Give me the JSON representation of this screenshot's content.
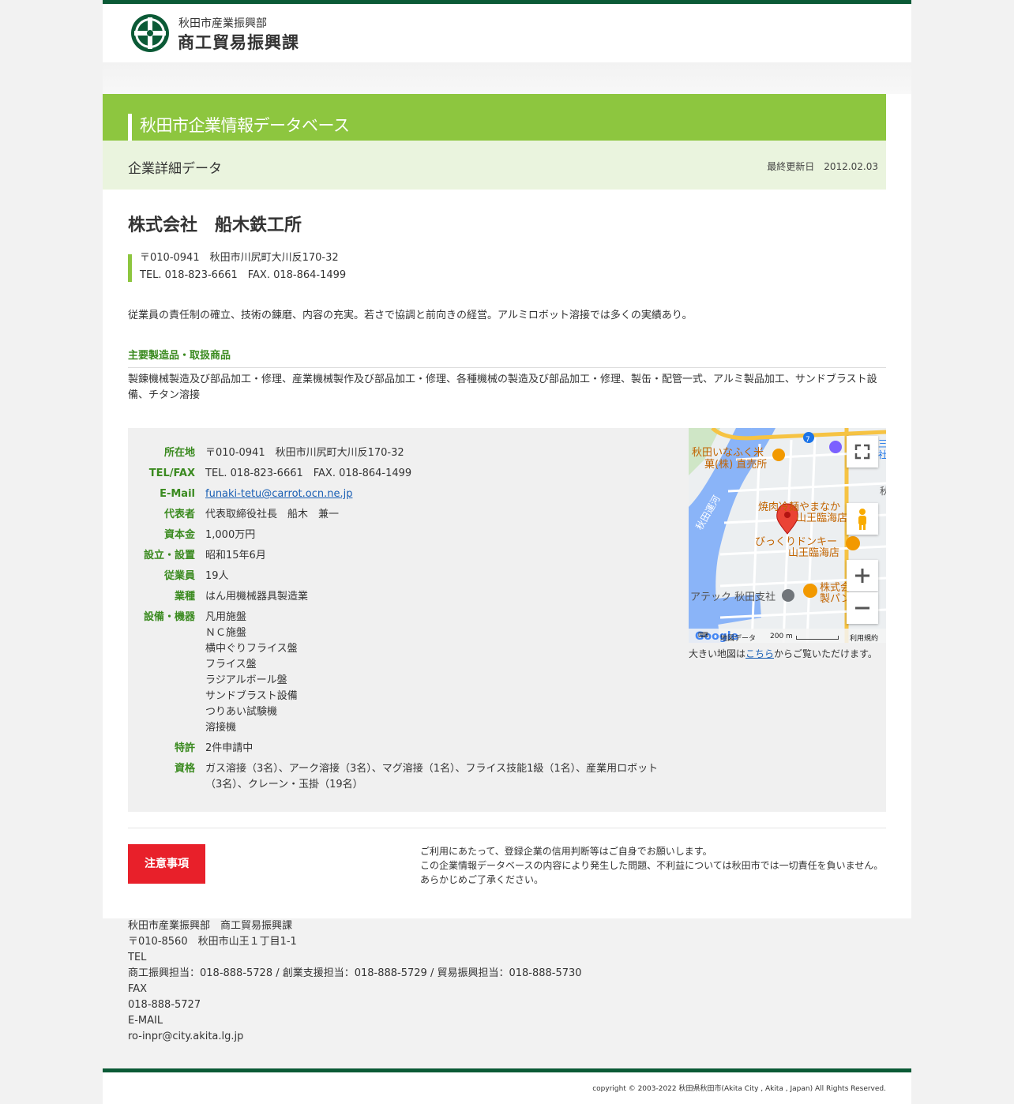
{
  "header": {
    "dept": "秋田市産業振興部",
    "section": "商工貿易振興課"
  },
  "db_title": "秋田市企業情報データベース",
  "detail": {
    "title": "企業詳細データ",
    "updated_label": "最終更新日　2012.02.03"
  },
  "company": {
    "name": "株式会社　船木鉄工所",
    "address_line": "〒010-0941　秋田市川尻町大川反170-32",
    "tel_line": "TEL. 018-823-6661　FAX. 018-864-1499",
    "description": "従業員の責任制の確立、技術の錬磨、内容の充実。若さで協調と前向きの経営。アルミロボット溶接では多くの実績あり。",
    "products_heading": "主要製造品・取扱商品",
    "products": "製錬機械製造及び部品加工・修理、産業機械製作及び部品加工・修理、各種機械の製造及び部品加工・修理、製缶・配管一式、アルミ製品加工、サンドブラスト設備、チタン溶接"
  },
  "info": {
    "location_label": "所在地",
    "location": "〒010-0941　秋田市川尻町大川反170-32",
    "telfax_label": "TEL/FAX",
    "telfax": "TEL. 018-823-6661　FAX. 018-864-1499",
    "email_label": "E-Mail",
    "email": "funaki-tetu@carrot.ocn.ne.jp",
    "rep_label": "代表者",
    "rep": "代表取締役社長　船木　兼一",
    "capital_label": "資本金",
    "capital": "1,000万円",
    "founded_label": "設立・設置",
    "founded": "昭和15年6月",
    "employees_label": "従業員",
    "employees": "19人",
    "industry_label": "業種",
    "industry": "はん用機械器具製造業",
    "equipment_label": "設備・機器",
    "equipment": [
      "凡用施盤",
      "ＮＣ施盤",
      "横中ぐりフライス盤",
      "フライス盤",
      "ラジアルボール盤",
      "サンドブラスト設備",
      "つりあい試験機",
      "溶接機"
    ],
    "patent_label": "特許",
    "patent": "2件申請中",
    "qual_label": "資格",
    "qual": "ガス溶接（3名）、アーク溶接（3名）、マグ溶接（1名）、フライス技能1級（1名）、産業用ロボット（3名）、クレーン・玉掛（19名）"
  },
  "map": {
    "labels": {
      "shop1a": "秋田いなふく米",
      "shop1b": "菓(株) 直売所",
      "river": "秋田運河",
      "rest1a": "焼肉冷麺やまなか",
      "rest1b": "山王臨海店",
      "rest2a": "びっくりドンキー",
      "rest2b": "山王臨海店",
      "company": "アテック 秋田支社",
      "other1": "株式会",
      "other2": "製パン",
      "route": "7",
      "edge1": "三",
      "edge2": "社",
      "edge3": "秋"
    },
    "footer_data": "地図データ",
    "scale": "200 m",
    "terms": "利用規約",
    "google": "Google",
    "hint_before": "大きい地図は",
    "hint_link": "こちら",
    "hint_after": "からご覧いただけます。"
  },
  "caution": {
    "button": "注意事項",
    "lines": [
      "ご利用にあたって、登録企業の信用判断等はご自身でお願いします。",
      "この企業情報データベースの内容により発生した問題、不利益については秋田市では一切責任を負いません。",
      "あらかじめご了承ください。"
    ]
  },
  "footer": {
    "lines": [
      "秋田市産業振興部　商工貿易振興課",
      "〒010-8560　秋田市山王１丁目1-1",
      "TEL",
      "商工振興担当：018-888-5728 / 創業支援担当：018-888-5729 / 貿易振興担当：018-888-5730",
      "FAX",
      "018-888-5727",
      "E-MAIL",
      "ro-inpr@city.akita.lg.jp"
    ],
    "copyright": "copyright © 2003-2022 秋田県秋田市(Akita City , Akita , Japan) All Rights Reserved."
  },
  "colors": {
    "brand_green": "#0b5a36",
    "accent_green": "#8dc63f",
    "label_green": "#3a8a1f",
    "caution_red": "#e8202a"
  }
}
